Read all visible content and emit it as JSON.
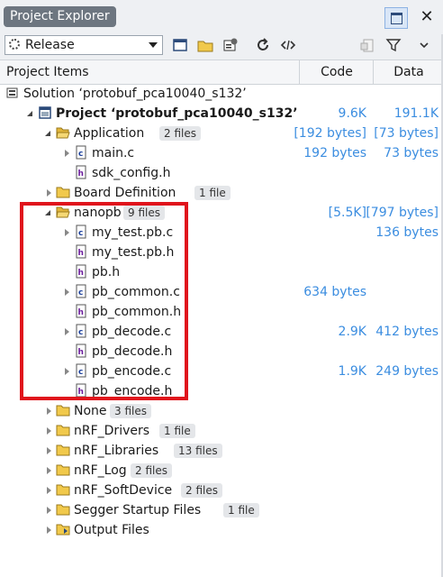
{
  "window": {
    "title": "Project Explorer",
    "maximize_icon": "maximize-icon",
    "close_icon": "close-icon"
  },
  "toolbar": {
    "configuration": "Release",
    "icons": [
      "properties-icon",
      "open-folder-icon",
      "build-options-icon",
      "refresh-icon",
      "code-icon",
      "new-file-icon",
      "filter-icon",
      "dropdown-icon"
    ]
  },
  "columns": {
    "items": "Project Items",
    "code": "Code",
    "data": "Data"
  },
  "tree": [
    {
      "label": "Solution ‘protobuf_pca10040_s132’",
      "type": "solution",
      "expander": "none",
      "badge": "",
      "code": "",
      "data": ""
    },
    {
      "label": "Project ‘protobuf_pca10040_s132’",
      "type": "project",
      "expander": "open",
      "badge": "",
      "code": "9.6K",
      "data": "191.1K"
    },
    {
      "label": "Application",
      "type": "folder-open",
      "expander": "open",
      "badge": "2 files",
      "code": "[192 bytes]",
      "data": "[73 bytes]"
    },
    {
      "label": "main.c",
      "type": "c-file",
      "expander": "closed",
      "badge": "",
      "code": "192 bytes",
      "data": "73 bytes"
    },
    {
      "label": "sdk_config.h",
      "type": "h-file",
      "expander": "none",
      "badge": "",
      "code": "",
      "data": ""
    },
    {
      "label": "Board Definition",
      "type": "folder",
      "expander": "closed",
      "badge": "1 file",
      "code": "",
      "data": ""
    },
    {
      "label": "nanopb",
      "type": "folder-open",
      "expander": "open",
      "badge": "9 files",
      "code": "[5.5K]",
      "data": "[797 bytes]"
    },
    {
      "label": "my_test.pb.c",
      "type": "c-file",
      "expander": "closed",
      "badge": "",
      "code": "",
      "data": "136 bytes"
    },
    {
      "label": "my_test.pb.h",
      "type": "h-file",
      "expander": "none",
      "badge": "",
      "code": "",
      "data": ""
    },
    {
      "label": "pb.h",
      "type": "h-file",
      "expander": "none",
      "badge": "",
      "code": "",
      "data": ""
    },
    {
      "label": "pb_common.c",
      "type": "c-file",
      "expander": "closed",
      "badge": "",
      "code": "634 bytes",
      "data": ""
    },
    {
      "label": "pb_common.h",
      "type": "h-file",
      "expander": "none",
      "badge": "",
      "code": "",
      "data": ""
    },
    {
      "label": "pb_decode.c",
      "type": "c-file",
      "expander": "closed",
      "badge": "",
      "code": "2.9K",
      "data": "412 bytes"
    },
    {
      "label": "pb_decode.h",
      "type": "h-file",
      "expander": "none",
      "badge": "",
      "code": "",
      "data": ""
    },
    {
      "label": "pb_encode.c",
      "type": "c-file",
      "expander": "closed",
      "badge": "",
      "code": "1.9K",
      "data": "249 bytes"
    },
    {
      "label": "pb_encode.h",
      "type": "h-file",
      "expander": "none",
      "badge": "",
      "code": "",
      "data": ""
    },
    {
      "label": "None",
      "type": "folder",
      "expander": "closed",
      "badge": "3 files",
      "code": "",
      "data": ""
    },
    {
      "label": "nRF_Drivers",
      "type": "folder",
      "expander": "closed",
      "badge": "1 file",
      "code": "",
      "data": ""
    },
    {
      "label": "nRF_Libraries",
      "type": "folder",
      "expander": "closed",
      "badge": "13 files",
      "code": "",
      "data": ""
    },
    {
      "label": "nRF_Log",
      "type": "folder",
      "expander": "closed",
      "badge": "2 files",
      "code": "",
      "data": ""
    },
    {
      "label": "nRF_SoftDevice",
      "type": "folder",
      "expander": "closed",
      "badge": "2 files",
      "code": "",
      "data": ""
    },
    {
      "label": "Segger Startup Files",
      "type": "folder",
      "expander": "closed",
      "badge": "1 file",
      "code": "",
      "data": ""
    },
    {
      "label": "Output Files",
      "type": "output-folder",
      "expander": "closed",
      "badge": "",
      "code": "",
      "data": ""
    }
  ],
  "colors": {
    "size_text": "#3b8de0",
    "highlight_border": "#e0141c",
    "title_pill": "#6d7680"
  }
}
